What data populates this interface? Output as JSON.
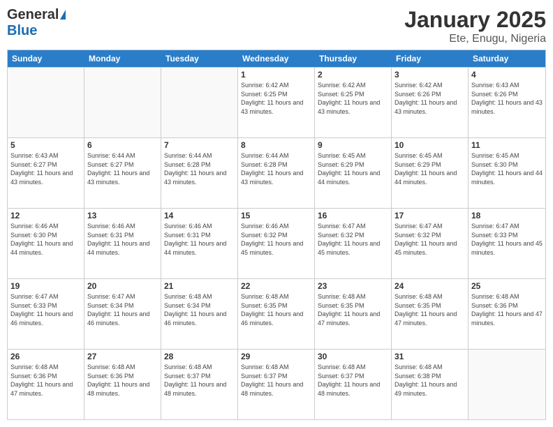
{
  "logo": {
    "general": "General",
    "blue": "Blue"
  },
  "title": "January 2025",
  "subtitle": "Ete, Enugu, Nigeria",
  "weekdays": [
    "Sunday",
    "Monday",
    "Tuesday",
    "Wednesday",
    "Thursday",
    "Friday",
    "Saturday"
  ],
  "weeks": [
    [
      {
        "date": "",
        "sunrise": "",
        "sunset": "",
        "daylight": ""
      },
      {
        "date": "",
        "sunrise": "",
        "sunset": "",
        "daylight": ""
      },
      {
        "date": "",
        "sunrise": "",
        "sunset": "",
        "daylight": ""
      },
      {
        "date": "1",
        "sunrise": "Sunrise: 6:42 AM",
        "sunset": "Sunset: 6:25 PM",
        "daylight": "Daylight: 11 hours and 43 minutes."
      },
      {
        "date": "2",
        "sunrise": "Sunrise: 6:42 AM",
        "sunset": "Sunset: 6:25 PM",
        "daylight": "Daylight: 11 hours and 43 minutes."
      },
      {
        "date": "3",
        "sunrise": "Sunrise: 6:42 AM",
        "sunset": "Sunset: 6:26 PM",
        "daylight": "Daylight: 11 hours and 43 minutes."
      },
      {
        "date": "4",
        "sunrise": "Sunrise: 6:43 AM",
        "sunset": "Sunset: 6:26 PM",
        "daylight": "Daylight: 11 hours and 43 minutes."
      }
    ],
    [
      {
        "date": "5",
        "sunrise": "Sunrise: 6:43 AM",
        "sunset": "Sunset: 6:27 PM",
        "daylight": "Daylight: 11 hours and 43 minutes."
      },
      {
        "date": "6",
        "sunrise": "Sunrise: 6:44 AM",
        "sunset": "Sunset: 6:27 PM",
        "daylight": "Daylight: 11 hours and 43 minutes."
      },
      {
        "date": "7",
        "sunrise": "Sunrise: 6:44 AM",
        "sunset": "Sunset: 6:28 PM",
        "daylight": "Daylight: 11 hours and 43 minutes."
      },
      {
        "date": "8",
        "sunrise": "Sunrise: 6:44 AM",
        "sunset": "Sunset: 6:28 PM",
        "daylight": "Daylight: 11 hours and 43 minutes."
      },
      {
        "date": "9",
        "sunrise": "Sunrise: 6:45 AM",
        "sunset": "Sunset: 6:29 PM",
        "daylight": "Daylight: 11 hours and 44 minutes."
      },
      {
        "date": "10",
        "sunrise": "Sunrise: 6:45 AM",
        "sunset": "Sunset: 6:29 PM",
        "daylight": "Daylight: 11 hours and 44 minutes."
      },
      {
        "date": "11",
        "sunrise": "Sunrise: 6:45 AM",
        "sunset": "Sunset: 6:30 PM",
        "daylight": "Daylight: 11 hours and 44 minutes."
      }
    ],
    [
      {
        "date": "12",
        "sunrise": "Sunrise: 6:46 AM",
        "sunset": "Sunset: 6:30 PM",
        "daylight": "Daylight: 11 hours and 44 minutes."
      },
      {
        "date": "13",
        "sunrise": "Sunrise: 6:46 AM",
        "sunset": "Sunset: 6:31 PM",
        "daylight": "Daylight: 11 hours and 44 minutes."
      },
      {
        "date": "14",
        "sunrise": "Sunrise: 6:46 AM",
        "sunset": "Sunset: 6:31 PM",
        "daylight": "Daylight: 11 hours and 44 minutes."
      },
      {
        "date": "15",
        "sunrise": "Sunrise: 6:46 AM",
        "sunset": "Sunset: 6:32 PM",
        "daylight": "Daylight: 11 hours and 45 minutes."
      },
      {
        "date": "16",
        "sunrise": "Sunrise: 6:47 AM",
        "sunset": "Sunset: 6:32 PM",
        "daylight": "Daylight: 11 hours and 45 minutes."
      },
      {
        "date": "17",
        "sunrise": "Sunrise: 6:47 AM",
        "sunset": "Sunset: 6:32 PM",
        "daylight": "Daylight: 11 hours and 45 minutes."
      },
      {
        "date": "18",
        "sunrise": "Sunrise: 6:47 AM",
        "sunset": "Sunset: 6:33 PM",
        "daylight": "Daylight: 11 hours and 45 minutes."
      }
    ],
    [
      {
        "date": "19",
        "sunrise": "Sunrise: 6:47 AM",
        "sunset": "Sunset: 6:33 PM",
        "daylight": "Daylight: 11 hours and 46 minutes."
      },
      {
        "date": "20",
        "sunrise": "Sunrise: 6:47 AM",
        "sunset": "Sunset: 6:34 PM",
        "daylight": "Daylight: 11 hours and 46 minutes."
      },
      {
        "date": "21",
        "sunrise": "Sunrise: 6:48 AM",
        "sunset": "Sunset: 6:34 PM",
        "daylight": "Daylight: 11 hours and 46 minutes."
      },
      {
        "date": "22",
        "sunrise": "Sunrise: 6:48 AM",
        "sunset": "Sunset: 6:35 PM",
        "daylight": "Daylight: 11 hours and 46 minutes."
      },
      {
        "date": "23",
        "sunrise": "Sunrise: 6:48 AM",
        "sunset": "Sunset: 6:35 PM",
        "daylight": "Daylight: 11 hours and 47 minutes."
      },
      {
        "date": "24",
        "sunrise": "Sunrise: 6:48 AM",
        "sunset": "Sunset: 6:35 PM",
        "daylight": "Daylight: 11 hours and 47 minutes."
      },
      {
        "date": "25",
        "sunrise": "Sunrise: 6:48 AM",
        "sunset": "Sunset: 6:36 PM",
        "daylight": "Daylight: 11 hours and 47 minutes."
      }
    ],
    [
      {
        "date": "26",
        "sunrise": "Sunrise: 6:48 AM",
        "sunset": "Sunset: 6:36 PM",
        "daylight": "Daylight: 11 hours and 47 minutes."
      },
      {
        "date": "27",
        "sunrise": "Sunrise: 6:48 AM",
        "sunset": "Sunset: 6:36 PM",
        "daylight": "Daylight: 11 hours and 48 minutes."
      },
      {
        "date": "28",
        "sunrise": "Sunrise: 6:48 AM",
        "sunset": "Sunset: 6:37 PM",
        "daylight": "Daylight: 11 hours and 48 minutes."
      },
      {
        "date": "29",
        "sunrise": "Sunrise: 6:48 AM",
        "sunset": "Sunset: 6:37 PM",
        "daylight": "Daylight: 11 hours and 48 minutes."
      },
      {
        "date": "30",
        "sunrise": "Sunrise: 6:48 AM",
        "sunset": "Sunset: 6:37 PM",
        "daylight": "Daylight: 11 hours and 48 minutes."
      },
      {
        "date": "31",
        "sunrise": "Sunrise: 6:48 AM",
        "sunset": "Sunset: 6:38 PM",
        "daylight": "Daylight: 11 hours and 49 minutes."
      },
      {
        "date": "",
        "sunrise": "",
        "sunset": "",
        "daylight": ""
      }
    ]
  ]
}
